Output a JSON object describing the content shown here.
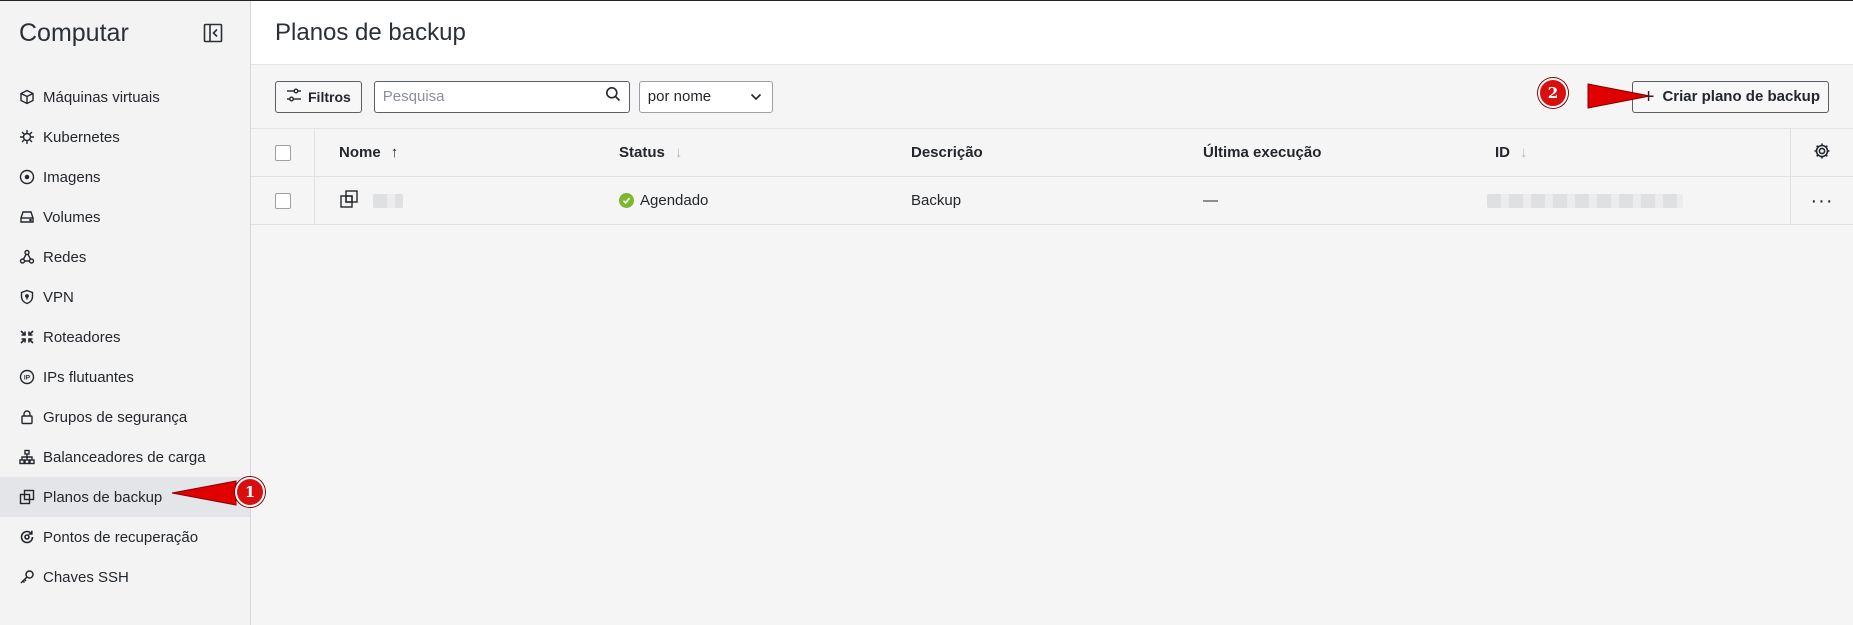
{
  "sidebar": {
    "title": "Computar",
    "items": [
      {
        "label": "Máquinas virtuais",
        "icon": "cube-icon"
      },
      {
        "label": "Kubernetes",
        "icon": "kubernetes-icon"
      },
      {
        "label": "Imagens",
        "icon": "disc-icon"
      },
      {
        "label": "Volumes",
        "icon": "drive-icon"
      },
      {
        "label": "Redes",
        "icon": "network-icon"
      },
      {
        "label": "VPN",
        "icon": "shield-icon"
      },
      {
        "label": "Roteadores",
        "icon": "router-icon"
      },
      {
        "label": "IPs flutuantes",
        "icon": "floating-ip-icon"
      },
      {
        "label": "Grupos de segurança",
        "icon": "lock-icon"
      },
      {
        "label": "Balanceadores de carga",
        "icon": "load-balancer-icon"
      },
      {
        "label": "Planos de backup",
        "icon": "backup-icon",
        "active": true
      },
      {
        "label": "Pontos de recuperação",
        "icon": "recovery-icon"
      },
      {
        "label": "Chaves SSH",
        "icon": "key-icon"
      }
    ]
  },
  "header": {
    "title": "Planos de backup"
  },
  "toolbar": {
    "filters_label": "Filtros",
    "search_placeholder": "Pesquisa",
    "search_value": "",
    "sort_value": "por nome",
    "create_label": "Criar plano de backup"
  },
  "table": {
    "columns": {
      "name": "Nome",
      "status": "Status",
      "description": "Descrição",
      "last_run": "Última execução",
      "id": "ID"
    },
    "rows": [
      {
        "status": "Agendado",
        "description": "Backup",
        "last_run": "—"
      }
    ]
  },
  "annotations": [
    {
      "number": "1"
    },
    {
      "number": "2"
    }
  ],
  "colors": {
    "annotation_red": "#d90f0f",
    "status_green": "#7cb82f"
  }
}
